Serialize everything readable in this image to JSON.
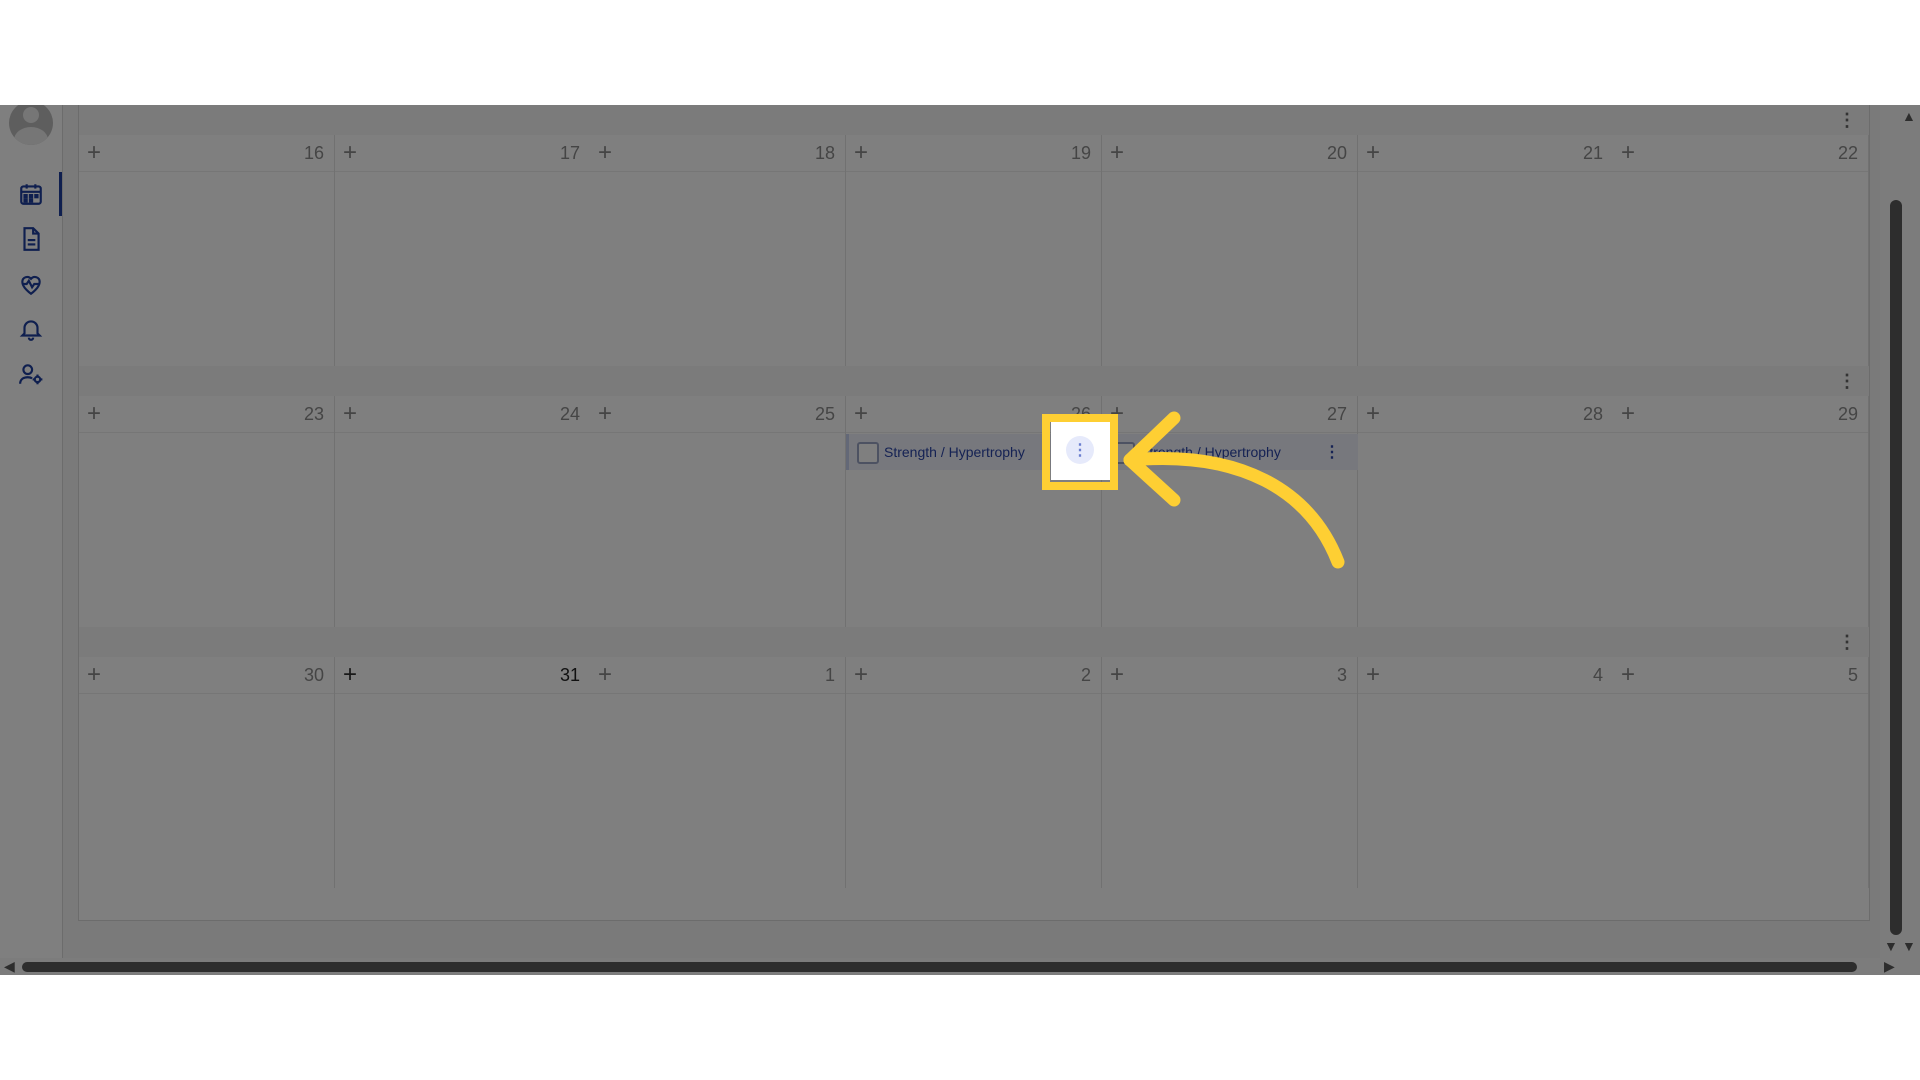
{
  "sidebar": {
    "items": [
      {
        "name": "calendar",
        "icon": "calendar-icon",
        "active": true
      },
      {
        "name": "documents",
        "icon": "document-icon",
        "active": false
      },
      {
        "name": "health",
        "icon": "heart-pulse-icon",
        "active": false
      },
      {
        "name": "notifications",
        "icon": "bell-icon",
        "active": false
      },
      {
        "name": "user-settings",
        "icon": "user-gear-icon",
        "active": false
      }
    ]
  },
  "weeks": [
    {
      "days": [
        {
          "num": "16"
        },
        {
          "num": "17"
        },
        {
          "num": "18"
        },
        {
          "num": "19"
        },
        {
          "num": "20"
        },
        {
          "num": "21"
        },
        {
          "num": "22"
        }
      ]
    },
    {
      "days": [
        {
          "num": "23"
        },
        {
          "num": "24"
        },
        {
          "num": "25"
        },
        {
          "num": "26",
          "event": {
            "title": "Strength / Hypertrophy"
          }
        },
        {
          "num": "27",
          "event": {
            "title": "Strength / Hypertrophy"
          }
        },
        {
          "num": "28"
        },
        {
          "num": "29"
        }
      ]
    },
    {
      "days": [
        {
          "num": "30"
        },
        {
          "num": "31",
          "today": true
        },
        {
          "num": "1"
        },
        {
          "num": "2"
        },
        {
          "num": "3"
        },
        {
          "num": "4"
        },
        {
          "num": "5"
        }
      ]
    }
  ],
  "glyphs": {
    "add": "+",
    "menu": "⋮",
    "scroll_up": "▲",
    "scroll_down": "▼",
    "scroll_left": "◀",
    "scroll_right": "▶"
  },
  "colors": {
    "accent": "#1f3f9e",
    "event_text": "#2b45a8",
    "highlight": "#fecf33"
  }
}
